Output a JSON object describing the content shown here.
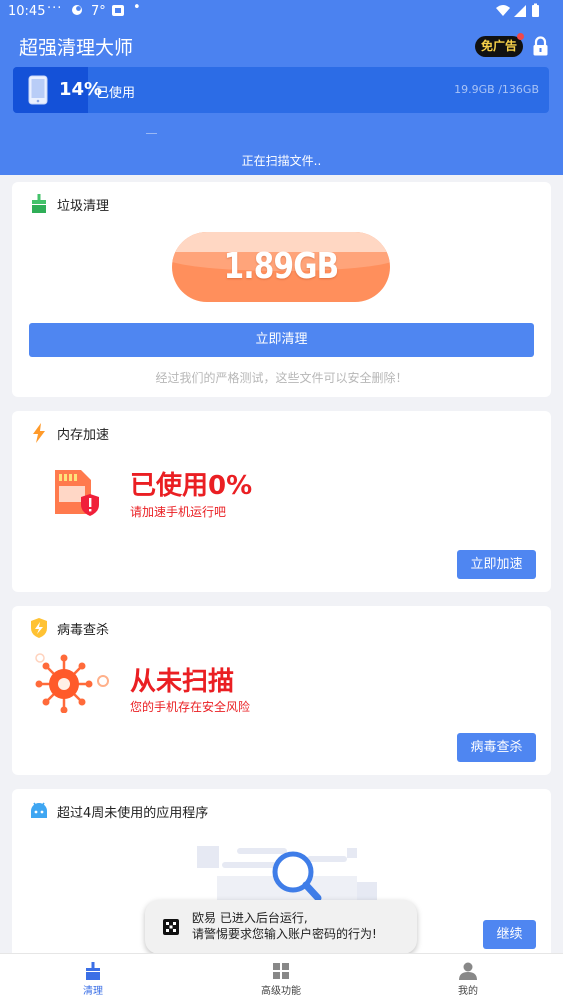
{
  "status_bar": {
    "time": "10:45",
    "dots": "···",
    "temperature": "7°",
    "dot": "•"
  },
  "header": {
    "title": "超强清理大师",
    "no_ads_label": "免广告",
    "storage": {
      "percent": "14%",
      "used_label": "已使用",
      "size": "19.9GB /136GB",
      "fill_fraction": 0.14
    },
    "scan_status": "正在扫描文件.."
  },
  "junk": {
    "title": "垃圾清理",
    "size": "1.89GB",
    "button": "立即清理",
    "note": "经过我们的严格测试，这些文件可以安全删除！"
  },
  "memory": {
    "title": "内存加速",
    "headline": "已使用0%",
    "sub": "请加速手机运行吧",
    "button": "立即加速"
  },
  "virus": {
    "title": "病毒查杀",
    "headline": "从未扫描",
    "sub": "您的手机存在安全风险",
    "button": "病毒查杀"
  },
  "apps": {
    "title": "超过4周未使用的应用程序",
    "button": "继续"
  },
  "toast": {
    "line1": "欧易 已进入后台运行,",
    "line2": "请警惕要求您输入账户密码的行为!"
  },
  "tabs": [
    {
      "label": "清理"
    },
    {
      "label": "高级功能"
    },
    {
      "label": "我的"
    }
  ],
  "colors": {
    "primary": "#4f86f1",
    "header": "#4b82f0",
    "alert_red": "#ea1f23",
    "junk_orange": "#ff8f5c"
  }
}
